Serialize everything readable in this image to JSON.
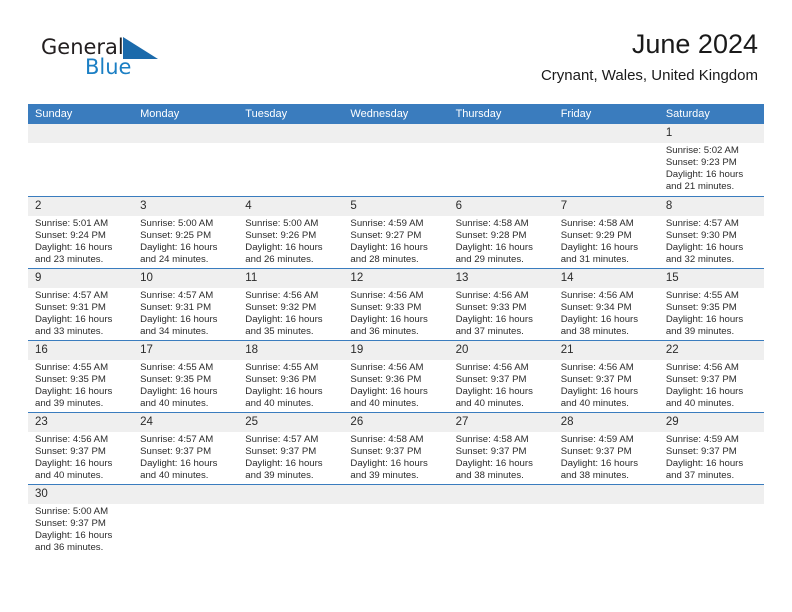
{
  "brand": {
    "name_top": "General",
    "name_bottom": "Blue",
    "logo_icon": "blue-flag-triangle-icon",
    "accent_color": "#1b7fc4"
  },
  "header": {
    "title": "June 2024",
    "subtitle": "Crynant, Wales, United Kingdom"
  },
  "calendar": {
    "header_bg": "#3a7cbe",
    "daynum_bg": "#efefef",
    "weekday_labels": [
      "Sunday",
      "Monday",
      "Tuesday",
      "Wednesday",
      "Thursday",
      "Friday",
      "Saturday"
    ],
    "weeks": [
      [
        {
          "day": "",
          "lines": []
        },
        {
          "day": "",
          "lines": []
        },
        {
          "day": "",
          "lines": []
        },
        {
          "day": "",
          "lines": []
        },
        {
          "day": "",
          "lines": []
        },
        {
          "day": "",
          "lines": []
        },
        {
          "day": "1",
          "lines": [
            "Sunrise: 5:02 AM",
            "Sunset: 9:23 PM",
            "Daylight: 16 hours",
            "and 21 minutes."
          ]
        }
      ],
      [
        {
          "day": "2",
          "lines": [
            "Sunrise: 5:01 AM",
            "Sunset: 9:24 PM",
            "Daylight: 16 hours",
            "and 23 minutes."
          ]
        },
        {
          "day": "3",
          "lines": [
            "Sunrise: 5:00 AM",
            "Sunset: 9:25 PM",
            "Daylight: 16 hours",
            "and 24 minutes."
          ]
        },
        {
          "day": "4",
          "lines": [
            "Sunrise: 5:00 AM",
            "Sunset: 9:26 PM",
            "Daylight: 16 hours",
            "and 26 minutes."
          ]
        },
        {
          "day": "5",
          "lines": [
            "Sunrise: 4:59 AM",
            "Sunset: 9:27 PM",
            "Daylight: 16 hours",
            "and 28 minutes."
          ]
        },
        {
          "day": "6",
          "lines": [
            "Sunrise: 4:58 AM",
            "Sunset: 9:28 PM",
            "Daylight: 16 hours",
            "and 29 minutes."
          ]
        },
        {
          "day": "7",
          "lines": [
            "Sunrise: 4:58 AM",
            "Sunset: 9:29 PM",
            "Daylight: 16 hours",
            "and 31 minutes."
          ]
        },
        {
          "day": "8",
          "lines": [
            "Sunrise: 4:57 AM",
            "Sunset: 9:30 PM",
            "Daylight: 16 hours",
            "and 32 minutes."
          ]
        }
      ],
      [
        {
          "day": "9",
          "lines": [
            "Sunrise: 4:57 AM",
            "Sunset: 9:31 PM",
            "Daylight: 16 hours",
            "and 33 minutes."
          ]
        },
        {
          "day": "10",
          "lines": [
            "Sunrise: 4:57 AM",
            "Sunset: 9:31 PM",
            "Daylight: 16 hours",
            "and 34 minutes."
          ]
        },
        {
          "day": "11",
          "lines": [
            "Sunrise: 4:56 AM",
            "Sunset: 9:32 PM",
            "Daylight: 16 hours",
            "and 35 minutes."
          ]
        },
        {
          "day": "12",
          "lines": [
            "Sunrise: 4:56 AM",
            "Sunset: 9:33 PM",
            "Daylight: 16 hours",
            "and 36 minutes."
          ]
        },
        {
          "day": "13",
          "lines": [
            "Sunrise: 4:56 AM",
            "Sunset: 9:33 PM",
            "Daylight: 16 hours",
            "and 37 minutes."
          ]
        },
        {
          "day": "14",
          "lines": [
            "Sunrise: 4:56 AM",
            "Sunset: 9:34 PM",
            "Daylight: 16 hours",
            "and 38 minutes."
          ]
        },
        {
          "day": "15",
          "lines": [
            "Sunrise: 4:55 AM",
            "Sunset: 9:35 PM",
            "Daylight: 16 hours",
            "and 39 minutes."
          ]
        }
      ],
      [
        {
          "day": "16",
          "lines": [
            "Sunrise: 4:55 AM",
            "Sunset: 9:35 PM",
            "Daylight: 16 hours",
            "and 39 minutes."
          ]
        },
        {
          "day": "17",
          "lines": [
            "Sunrise: 4:55 AM",
            "Sunset: 9:35 PM",
            "Daylight: 16 hours",
            "and 40 minutes."
          ]
        },
        {
          "day": "18",
          "lines": [
            "Sunrise: 4:55 AM",
            "Sunset: 9:36 PM",
            "Daylight: 16 hours",
            "and 40 minutes."
          ]
        },
        {
          "day": "19",
          "lines": [
            "Sunrise: 4:56 AM",
            "Sunset: 9:36 PM",
            "Daylight: 16 hours",
            "and 40 minutes."
          ]
        },
        {
          "day": "20",
          "lines": [
            "Sunrise: 4:56 AM",
            "Sunset: 9:37 PM",
            "Daylight: 16 hours",
            "and 40 minutes."
          ]
        },
        {
          "day": "21",
          "lines": [
            "Sunrise: 4:56 AM",
            "Sunset: 9:37 PM",
            "Daylight: 16 hours",
            "and 40 minutes."
          ]
        },
        {
          "day": "22",
          "lines": [
            "Sunrise: 4:56 AM",
            "Sunset: 9:37 PM",
            "Daylight: 16 hours",
            "and 40 minutes."
          ]
        }
      ],
      [
        {
          "day": "23",
          "lines": [
            "Sunrise: 4:56 AM",
            "Sunset: 9:37 PM",
            "Daylight: 16 hours",
            "and 40 minutes."
          ]
        },
        {
          "day": "24",
          "lines": [
            "Sunrise: 4:57 AM",
            "Sunset: 9:37 PM",
            "Daylight: 16 hours",
            "and 40 minutes."
          ]
        },
        {
          "day": "25",
          "lines": [
            "Sunrise: 4:57 AM",
            "Sunset: 9:37 PM",
            "Daylight: 16 hours",
            "and 39 minutes."
          ]
        },
        {
          "day": "26",
          "lines": [
            "Sunrise: 4:58 AM",
            "Sunset: 9:37 PM",
            "Daylight: 16 hours",
            "and 39 minutes."
          ]
        },
        {
          "day": "27",
          "lines": [
            "Sunrise: 4:58 AM",
            "Sunset: 9:37 PM",
            "Daylight: 16 hours",
            "and 38 minutes."
          ]
        },
        {
          "day": "28",
          "lines": [
            "Sunrise: 4:59 AM",
            "Sunset: 9:37 PM",
            "Daylight: 16 hours",
            "and 38 minutes."
          ]
        },
        {
          "day": "29",
          "lines": [
            "Sunrise: 4:59 AM",
            "Sunset: 9:37 PM",
            "Daylight: 16 hours",
            "and 37 minutes."
          ]
        }
      ],
      [
        {
          "day": "30",
          "lines": [
            "Sunrise: 5:00 AM",
            "Sunset: 9:37 PM",
            "Daylight: 16 hours",
            "and 36 minutes."
          ]
        },
        {
          "day": "",
          "lines": []
        },
        {
          "day": "",
          "lines": []
        },
        {
          "day": "",
          "lines": []
        },
        {
          "day": "",
          "lines": []
        },
        {
          "day": "",
          "lines": []
        },
        {
          "day": "",
          "lines": []
        }
      ]
    ]
  }
}
